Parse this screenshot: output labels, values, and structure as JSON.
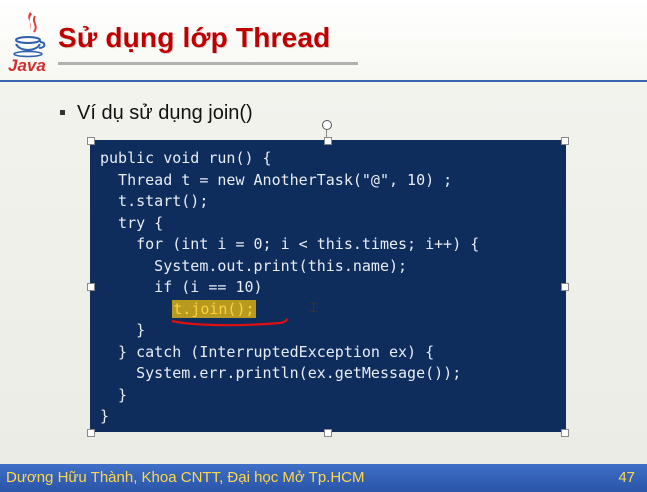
{
  "header": {
    "logo_text": "Java",
    "title": "Sử dụng lớp Thread"
  },
  "content": {
    "bullet": "Ví dụ sử dụng join()",
    "code": {
      "before_highlight": "public void run() {\n  Thread t = new AnotherTask(\"@\", 10) ;\n  t.start();\n  try {\n    for (int i = 0; i < this.times; i++) {\n      System.out.print(this.name);\n      if (i == 10)\n        ",
      "highlight": "t.join();",
      "after_highlight": "\n    }\n  } catch (InterruptedException ex) {\n    System.err.println(ex.getMessage());\n  }\n}"
    }
  },
  "footer": {
    "text": "Dương Hữu Thành, Khoa CNTT, Đại học Mở Tp.HCM",
    "page_number": "47"
  },
  "colors": {
    "title": "#c00000",
    "code_background": "#0e2c5c",
    "highlight": "#b79a1f",
    "footer_background": "#2a55a8",
    "footer_text": "#ffd84a"
  }
}
